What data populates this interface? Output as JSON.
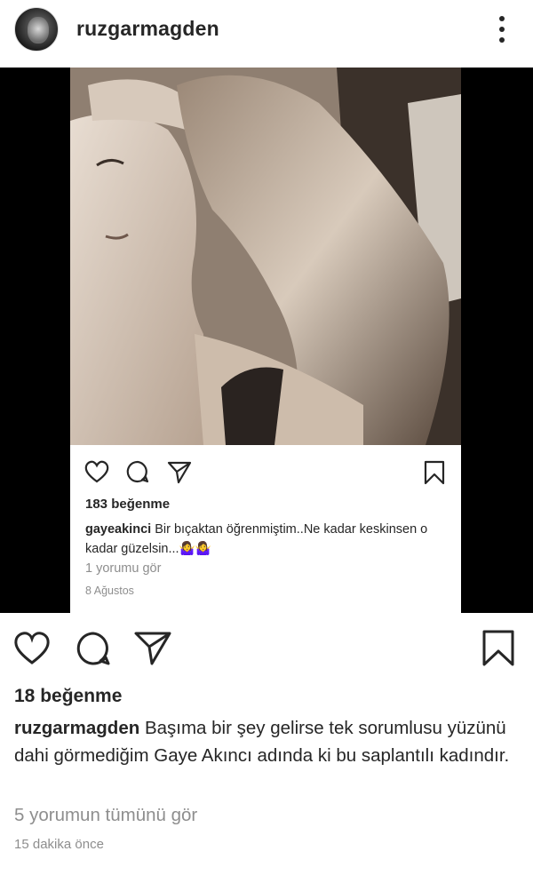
{
  "header": {
    "username": "ruzgarmagden"
  },
  "inner_post": {
    "likes": "183 beğenme",
    "caption_user": "gayeakinci",
    "caption_text": " Bir bıçaktan öğrenmiştim..Ne kadar keskinsen o kadar güzelsin...🤷‍♀️🤷‍♀️",
    "view_comments": "1 yorumu gör",
    "date": "8 Ağustos"
  },
  "post": {
    "likes": "18 beğenme",
    "caption_user": "ruzgarmagden",
    "caption_text": " Başıma bir şey gelirse tek sorumlusu yüzünü dahi görmediğim Gaye Akıncı adında ki bu saplantılı kadındır.",
    "view_all_comments": "5 yorumun tümünü gör",
    "timestamp": "15 dakika önce"
  },
  "icons": {
    "like": "heart-icon",
    "comment": "comment-icon",
    "share": "paper-plane-icon",
    "save": "bookmark-icon",
    "more": "more-vertical-icon"
  }
}
